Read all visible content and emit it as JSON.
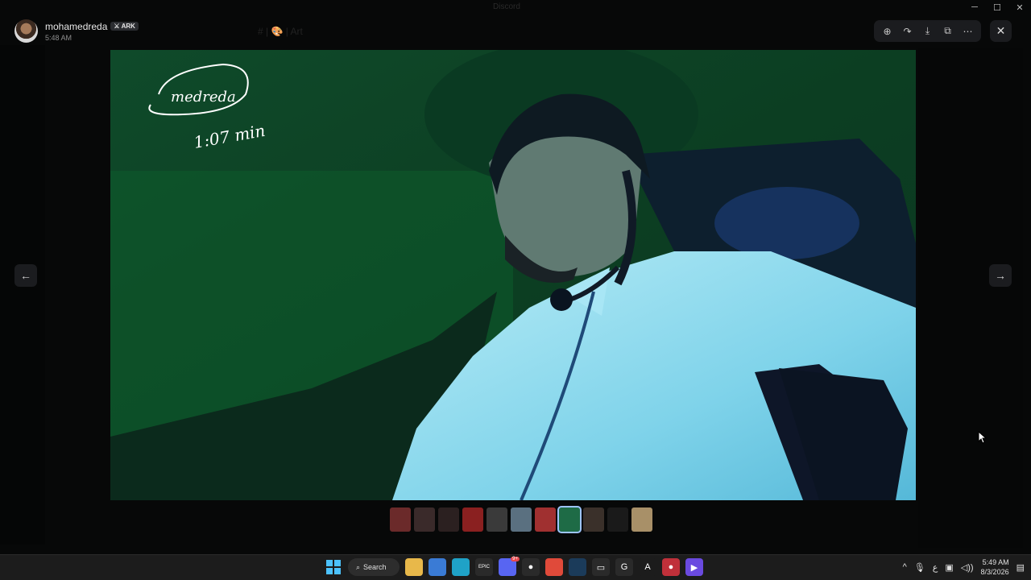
{
  "window": {
    "title": "Discord",
    "channel": "# | 🎨 | Art",
    "controls": [
      "─",
      "☐",
      "✕"
    ]
  },
  "author": {
    "name": "mohamedreda",
    "badge": "ARK",
    "time": "5:48 AM"
  },
  "toolbar": {
    "tools": [
      {
        "name": "zoom-in-icon",
        "glyph": "⊕"
      },
      {
        "name": "forward-icon",
        "glyph": "↷"
      },
      {
        "name": "download-icon",
        "glyph": "⤓"
      },
      {
        "name": "open-external-icon",
        "glyph": "⧉"
      },
      {
        "name": "more-icon",
        "glyph": "⋯"
      }
    ],
    "close": "✕"
  },
  "nav": {
    "prev": "←",
    "next": "→"
  },
  "image": {
    "handwriting_name": "medreda",
    "handwriting_time": "1:07 min"
  },
  "thumbnails": [
    {
      "color": "#6b2a2a"
    },
    {
      "color": "#3a2a2a"
    },
    {
      "color": "#2b2020"
    },
    {
      "color": "#8a2020"
    },
    {
      "color": "#3a3a3a"
    },
    {
      "color": "#5a7080"
    },
    {
      "color": "#a03030"
    },
    {
      "color": "#1e6b46",
      "active": true
    },
    {
      "color": "#3a302a"
    },
    {
      "color": "#1a1a1a"
    },
    {
      "color": "#a89068"
    }
  ],
  "taskbar": {
    "search_label": "Search",
    "apps": [
      {
        "name": "file-explorer-icon",
        "glyph": "",
        "color": "#e8b84a"
      },
      {
        "name": "store-icon",
        "glyph": "",
        "color": "#3a7bd5"
      },
      {
        "name": "edge-icon",
        "glyph": "",
        "color": "#1fa2c7"
      },
      {
        "name": "epic-games-icon",
        "glyph": "EPIC",
        "color": "#2a2a2a"
      },
      {
        "name": "discord-icon",
        "glyph": "",
        "color": "#5865f2",
        "badge": "9+"
      },
      {
        "name": "obs-icon",
        "glyph": "●",
        "color": "#2a2a2a"
      },
      {
        "name": "chrome-icon",
        "glyph": "",
        "color": "#e04a3a"
      },
      {
        "name": "steam-icon",
        "glyph": "",
        "color": "#1b3b5a"
      },
      {
        "name": "keyboard-app-icon",
        "glyph": "▭",
        "color": "#2a2a2a"
      },
      {
        "name": "g-app-icon",
        "glyph": "G",
        "color": "#2a2a2a"
      },
      {
        "name": "a-app-icon",
        "glyph": "A",
        "color": "#1c1c1c"
      },
      {
        "name": "recorder-app-icon",
        "glyph": "●",
        "color": "#c0303a"
      },
      {
        "name": "video-app-icon",
        "glyph": "▶",
        "color": "#6a4ae0"
      }
    ],
    "tray": {
      "chevron": "^",
      "mic": "🎙",
      "language": "ع",
      "time": "5:49 AM",
      "date": "8/3/2026"
    }
  }
}
